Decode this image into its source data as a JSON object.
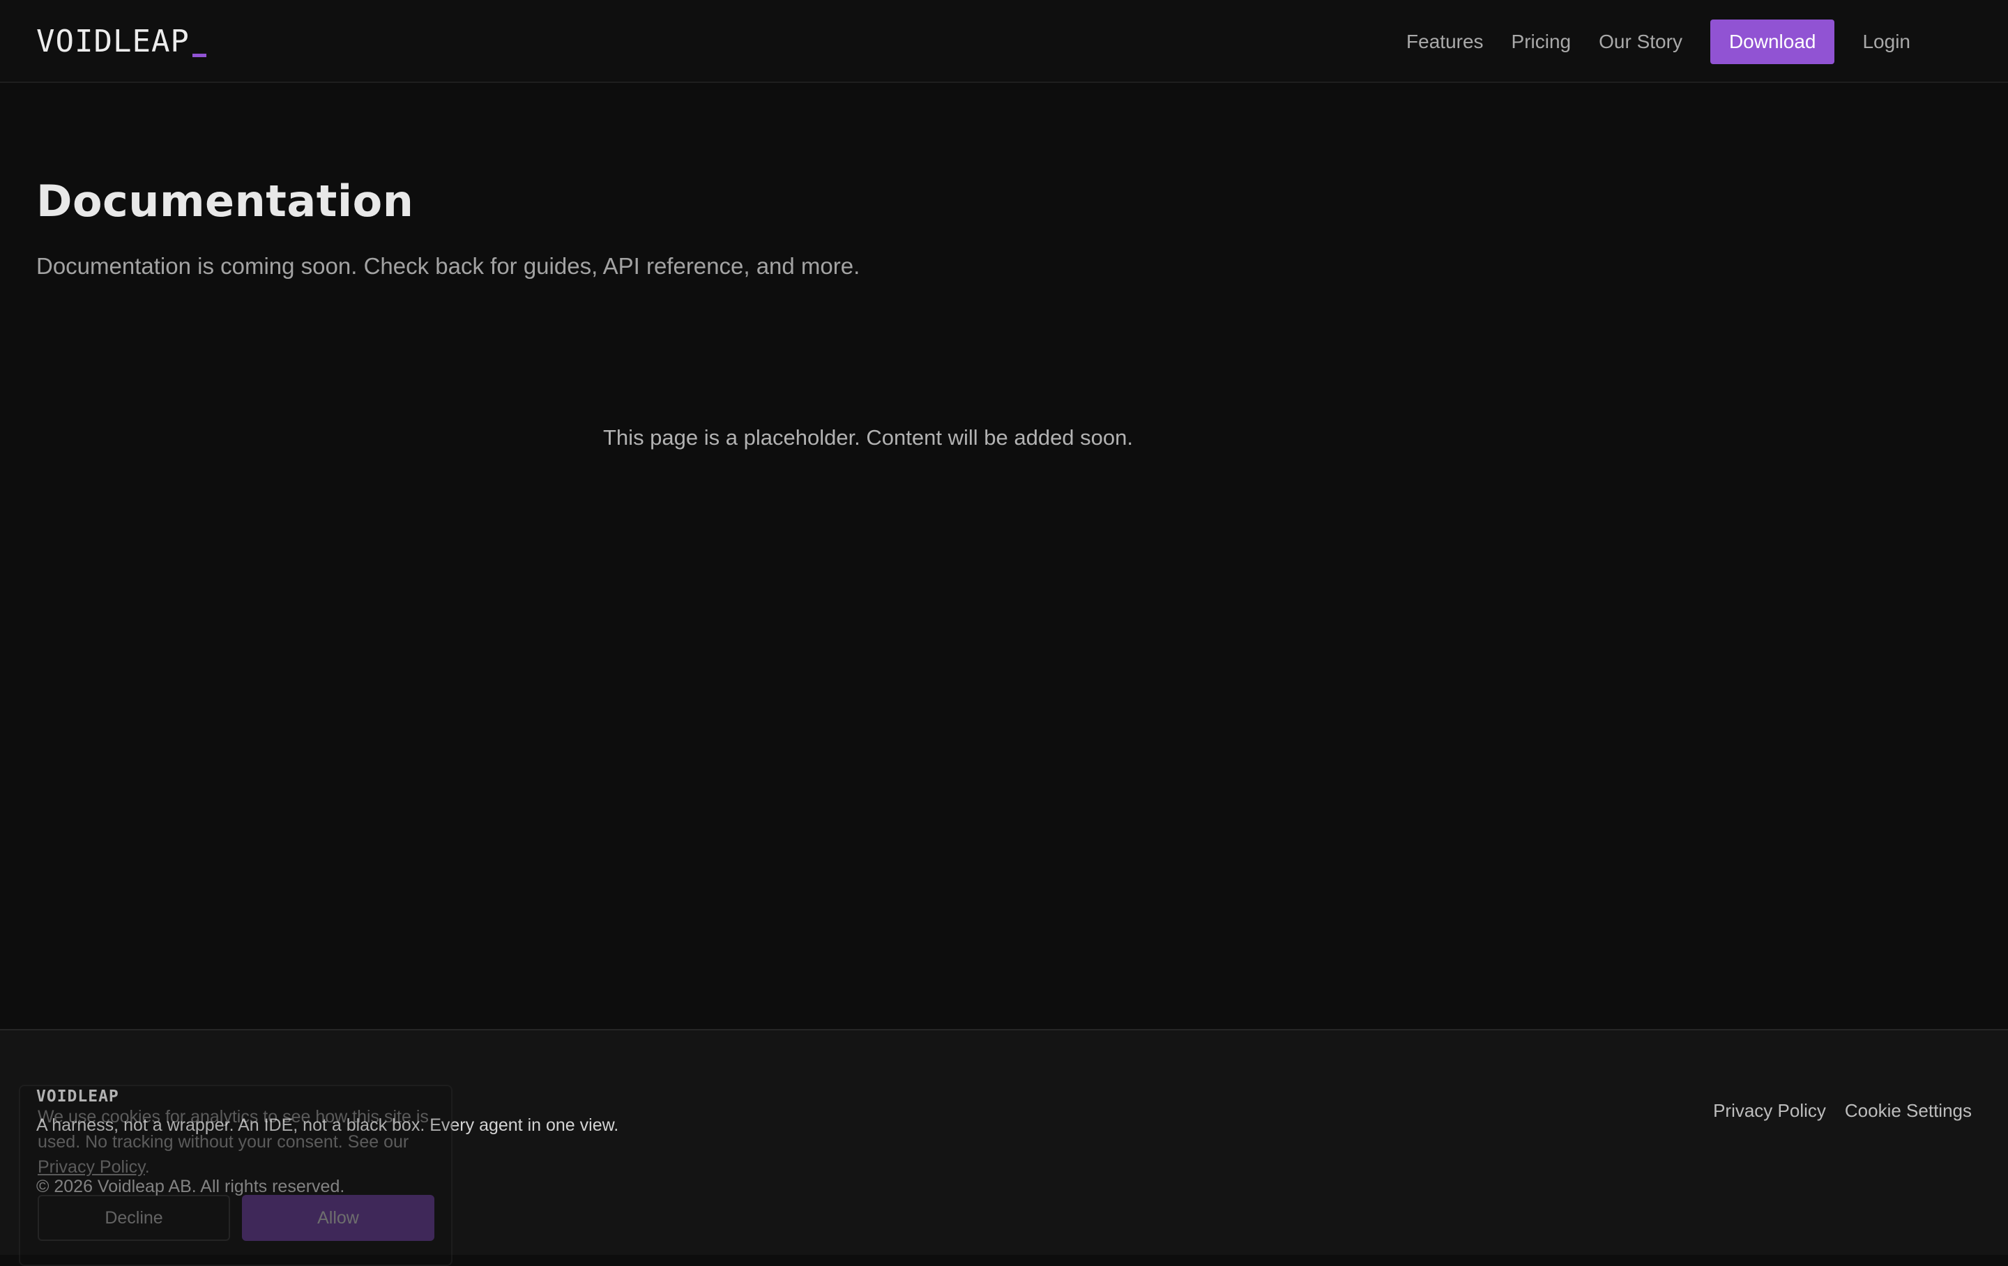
{
  "header": {
    "logo_text": "VOIDLEAP",
    "logo_cursor": "_",
    "nav": {
      "features": "Features",
      "pricing": "Pricing",
      "our_story": "Our Story",
      "download": "Download",
      "login": "Login"
    }
  },
  "main": {
    "title": "Documentation",
    "subtitle": "Documentation is coming soon. Check back for guides, API reference, and more.",
    "placeholder": "This page is a placeholder. Content will be added soon."
  },
  "footer": {
    "logo_text": "VOIDLEAP",
    "tagline": "A harness, not a wrapper. An IDE, not a black box. Every agent in one view.",
    "copyright": "© 2026 Voidleap AB. All rights reserved.",
    "links": {
      "privacy_policy": "Privacy Policy",
      "cookie_settings": "Cookie Settings"
    }
  },
  "cookie_banner": {
    "text_before_link": "We use cookies for analytics to see how this site is used. No tracking without your consent. See our ",
    "link_text": "Privacy Policy",
    "text_after_link": ".",
    "decline_label": "Decline",
    "allow_label": "Allow"
  },
  "colors": {
    "accent": "#9153d3",
    "background": "#0d0d0d",
    "footer_background": "#141414"
  }
}
